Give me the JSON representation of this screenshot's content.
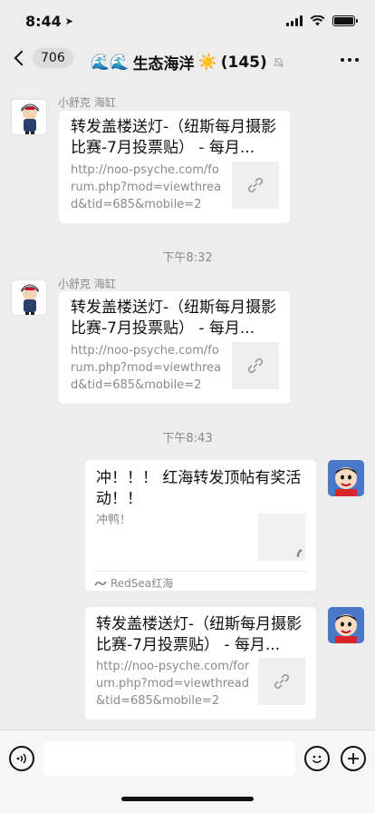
{
  "status_bar": {
    "time": "8:44"
  },
  "nav": {
    "unread_count": "706",
    "title_emoji": "🌊🌊",
    "title": "生态海洋",
    "title_sun": "☀️",
    "member_count": "(145)"
  },
  "messages": [
    {
      "sender": "小舒克 海缸",
      "title": "转发盖楼送灯-（纽斯每月摄影比赛-7月投票贴） - 每月...",
      "desc": "http://noo-psyche.com/forum.php?mod=viewthread&tid=685&mobile=2"
    },
    {
      "sender": "小舒克 海缸",
      "title": "转发盖楼送灯-（纽斯每月摄影比赛-7月投票贴） - 每月...",
      "desc": "http://noo-psyche.com/forum.php?mod=viewthread&tid=685&mobile=2"
    },
    {
      "title_line1": "冲！！！ 红海转发顶帖有奖活",
      "title_line2": "动！！",
      "desc": "冲鸭！",
      "source": "RedSea红海"
    },
    {
      "title": "转发盖楼送灯-（纽斯每月摄影比赛-7月投票贴） - 每月...",
      "desc": "http://noo-psyche.com/forum.php?mod=viewthread&tid=685&mobile=2"
    }
  ],
  "timestamps": [
    "下午8:32",
    "下午8:43"
  ],
  "icons": {
    "location": "location-arrow-icon",
    "mute": "mute-bell-icon",
    "link": "link-icon",
    "voice": "voice-icon",
    "emoji": "emoji-icon",
    "plus": "plus-icon"
  }
}
